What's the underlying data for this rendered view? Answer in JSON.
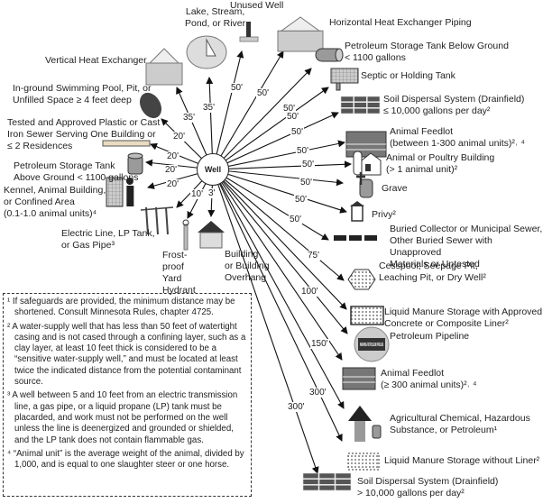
{
  "center_label": "Well",
  "items": [
    {
      "label": "Lake, Stream,\nPond, or River",
      "distance": "35'",
      "icon": "lake-icon"
    },
    {
      "label": "Unused Well",
      "distance": "50'",
      "icon": "hand-pump-icon"
    },
    {
      "label": "Vertical Heat Exchanger",
      "distance": "35'",
      "icon": "vertical-heat-exchanger-icon"
    },
    {
      "label": "Horizontal Heat Exchanger Piping",
      "distance": "50'",
      "icon": "horizontal-heat-exchanger-icon"
    },
    {
      "label": "In-ground Swimming Pool, Pit, or\nUnfilled Space ≥ 4 feet deep",
      "distance": "20'",
      "icon": "pool-icon"
    },
    {
      "label": "Petroleum Storage Tank Below Ground\n< 1100 gallons",
      "distance": "50'",
      "icon": "horizontal-tank-icon"
    },
    {
      "label": "Tested and Approved Plastic or Cast\nIron Sewer Serving One Building or\n≤ 2 Residences",
      "distance": "20'",
      "icon": "pipe-icon"
    },
    {
      "label": "Septic or Holding Tank",
      "distance": "50'",
      "icon": "septic-tank-icon"
    },
    {
      "label": "Petroleum Storage Tank\nAbove Ground < 1100 gallons",
      "distance": "20'",
      "icon": "tank-icon"
    },
    {
      "label": "Soil Dispersal System (Drainfield)\n≤ 10,000 gallons per day²",
      "distance": "50'",
      "icon": "drainfield-icon"
    },
    {
      "label": "Kennel, Animal Building,\nor Confined Area\n(0.1-1.0 animal units)⁴",
      "distance": "20'",
      "icon": "kennel-icon"
    },
    {
      "label": "Animal Feedlot\n(between 1-300 animal units)²˒ ⁴",
      "distance": "50'",
      "icon": "feedlot-icon"
    },
    {
      "label": "Electric Line, LP Tank,\nor Gas Pipe³",
      "distance": "10'",
      "icon": "utility-pole-icon"
    },
    {
      "label": "Frost-\nproof\nYard\nHydrant",
      "distance": "",
      "icon": "hydrant-icon"
    },
    {
      "label": "Building\nor Building\nOverhang",
      "distance": "3'",
      "icon": "house-icon"
    },
    {
      "label": "Animal or Poultry Building\n(> 1 animal unit)²",
      "distance": "50'",
      "icon": "barn-icon"
    },
    {
      "label": "Grave",
      "distance": "50'",
      "icon": "gravestone-icon"
    },
    {
      "label": "Privy²",
      "distance": "50'",
      "icon": "privy-icon"
    },
    {
      "label": "Buried Collector or Municipal Sewer,\nOther Buried Sewer with Unapproved\nMaterials or Untested",
      "distance": "50'",
      "icon": "buried-sewer-icon"
    },
    {
      "label": "Cesspool, Seepage Pit,\nLeaching Pit, or Dry Well²",
      "distance": "75'",
      "icon": "cesspool-icon"
    },
    {
      "label": "Liquid Manure Storage with Approved\nConcrete or Composite Liner²",
      "distance": "100'",
      "icon": "lined-manure-icon"
    },
    {
      "label": "Petroleum Pipeline",
      "distance": "",
      "icon": "pipeline-warning-icon",
      "icon_text": "WARNING PETROLEUM PIPELINE"
    },
    {
      "label": "Animal Feedlot\n(≥ 300 animal units)²˒ ⁴",
      "distance": "",
      "icon": "feedlot-icon"
    },
    {
      "label": "Agricultural Chemical, Hazardous\nSubstance, or Petroleum¹",
      "distance": "150'",
      "icon": "chemical-icon"
    },
    {
      "label": "Liquid Manure Storage without Liner²",
      "distance": "300'",
      "icon": "unlined-manure-icon"
    },
    {
      "label": "Soil Dispersal System (Drainfield)\n> 10,000 gallons per day²",
      "distance": "300'",
      "icon": "drainfield-icon"
    }
  ],
  "footnotes": [
    "¹ If safeguards are provided, the minimum distance may be shortened. Consult Minnesota Rules, chapter 4725.",
    "² A water-supply well that has less than 50 feet of watertight casing and is not cased through a confining layer, such as a clay layer, at least 10 feet thick is considered to be a “sensitive water-supply well,” and must be located at least twice the indicated distance from the potential contaminant source.",
    "³ A well between 5 and 10 feet from an electric transmission line, a gas pipe, or a liquid propane (LP) tank must be placarded, and work must not be performed on the well unless the line is deenergized and grounded or shielded, and the LP tank does not contain flammable gas.",
    "⁴ “Animal unit” is the average weight of the animal, divided by 1,000, and is equal to one slaughter steer or one horse."
  ],
  "colors": {
    "line": "#111111",
    "icon_fill": "#9a9a9a",
    "icon_dark": "#333333"
  }
}
